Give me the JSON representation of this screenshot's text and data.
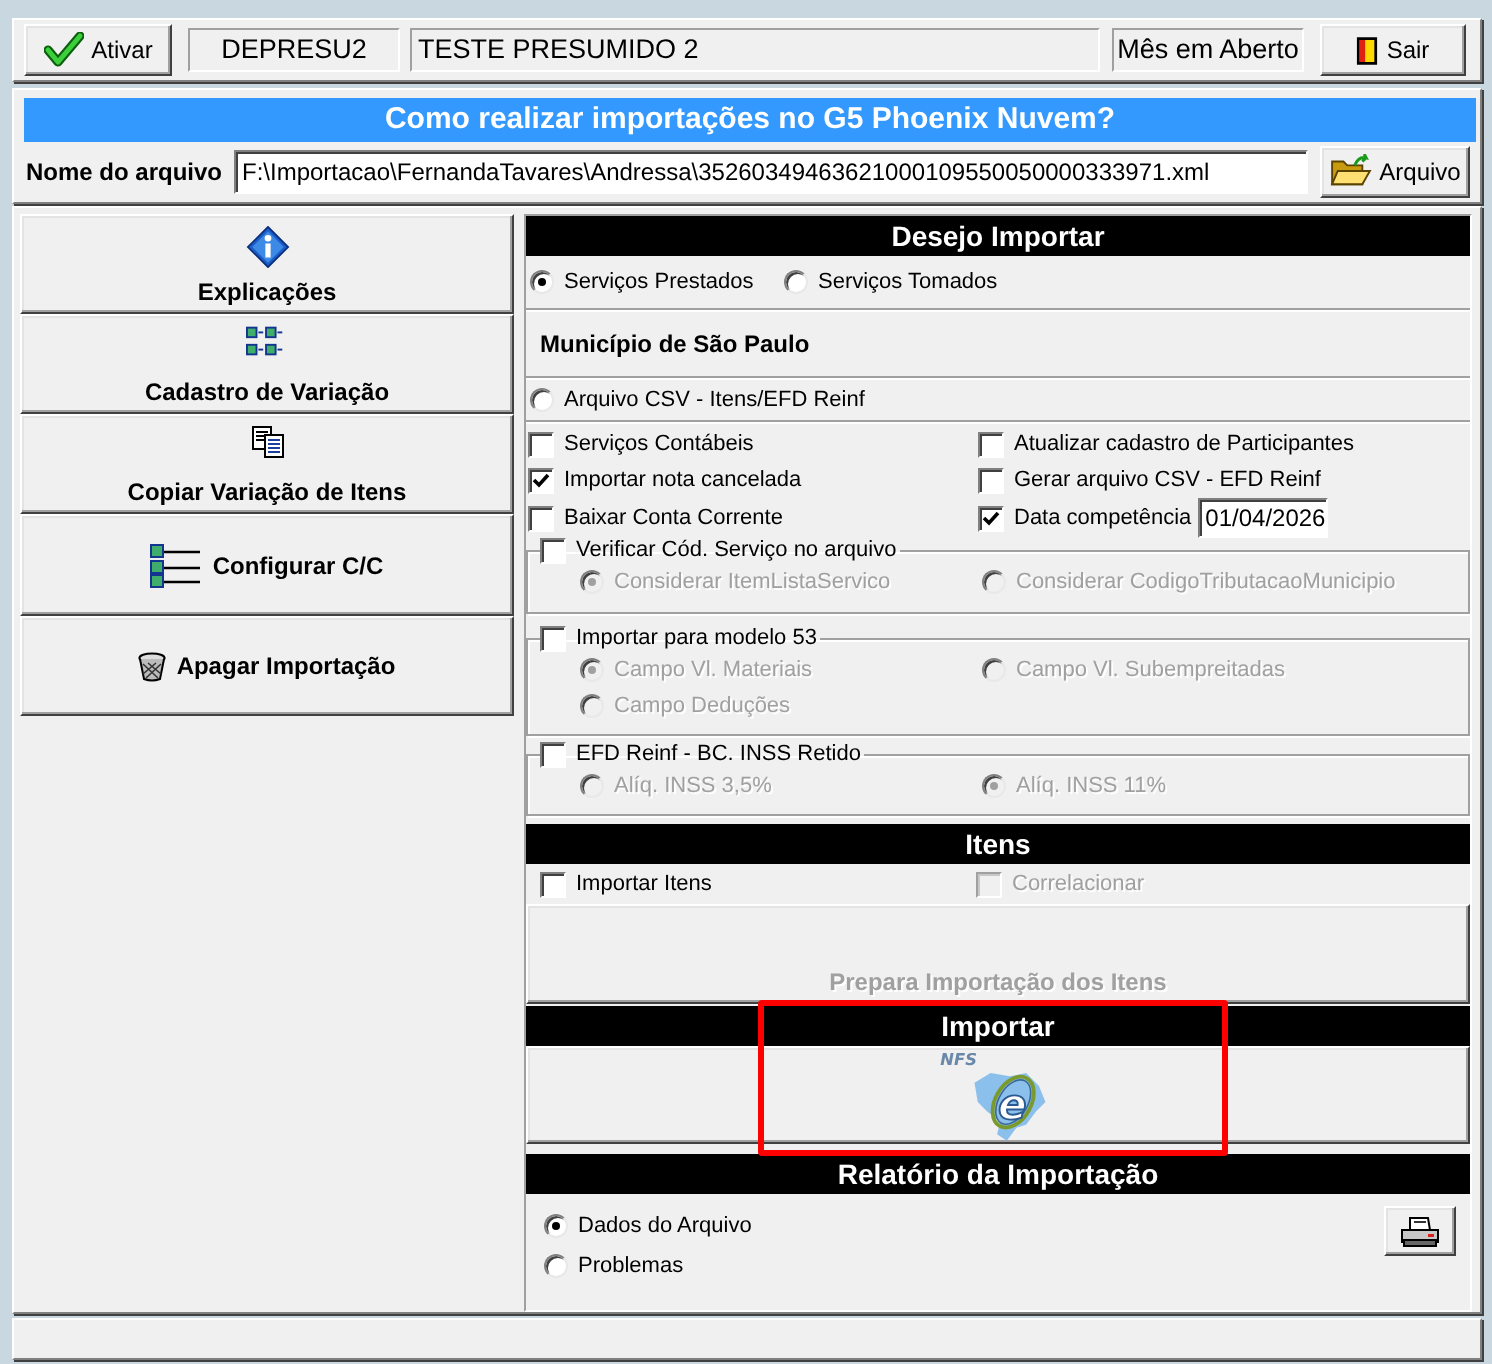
{
  "toolbar": {
    "activate_button": {
      "label": "Ativar"
    },
    "fields": [
      "DEPRESU2",
      "TESTE PRESUMIDO 2",
      "Mês em Aberto"
    ],
    "exit_button": {
      "label": "Sair"
    }
  },
  "file_panel": {
    "title": "Como realizar importações no G5 Phoenix Nuvem?",
    "file_label": "Nome do arquivo",
    "file_path": "F:\\Importacao\\FernandaTavares\\Andressa\\35260349463621000109550050000333971.xml",
    "browse_button": "Arquivo"
  },
  "sidebar": {
    "items": [
      {
        "kind": "info",
        "label": "Explicações"
      },
      {
        "kind": "variation",
        "label": "Cadastro de Variação"
      },
      {
        "kind": "copy",
        "label": "Copiar Variação de Itens"
      },
      {
        "kind": "config",
        "label": "Configurar C/C"
      },
      {
        "kind": "delete",
        "label": "Apagar Importação"
      }
    ]
  },
  "import_panel": {
    "title": "Desejo Importar",
    "service_types": [
      {
        "label": "Serviços Prestados",
        "selected": true
      },
      {
        "label": "Serviços Tomados",
        "selected": false
      }
    ],
    "municipality": "Município de São Paulo",
    "csv_option": {
      "label": "Arquivo CSV - Itens/EFD Reinf",
      "selected": false
    },
    "options": [
      {
        "label": "Serviços Contábeis",
        "checked": false
      },
      {
        "label": "Atualizar cadastro de Participantes",
        "checked": false
      },
      {
        "label": "Importar nota cancelada",
        "checked": true
      },
      {
        "label": "Gerar arquivo CSV - EFD Reinf",
        "checked": false
      },
      {
        "label": "Baixar Conta Corrente",
        "checked": false
      },
      {
        "label": "Data competência",
        "checked": true,
        "date": "01/04/2026"
      }
    ],
    "groups": [
      {
        "label": "Verificar Cód. Serviço no arquivo",
        "checked": false,
        "options": [
          {
            "label": "Considerar ItemListaServico",
            "selected": true,
            "disabled": true
          },
          {
            "label": "Considerar CodigoTributacaoMunicipio",
            "selected": false,
            "disabled": true
          }
        ]
      },
      {
        "label": "Importar para modelo 53",
        "checked": false,
        "options": [
          {
            "label": "Campo Vl. Materiais",
            "selected": true,
            "disabled": true
          },
          {
            "label": "Campo Vl. Subempreitadas",
            "selected": false,
            "disabled": true
          },
          {
            "label": "Campo Deduções",
            "selected": false,
            "disabled": true
          }
        ]
      },
      {
        "label": "EFD Reinf - BC. INSS Retido",
        "checked": false,
        "options": [
          {
            "label": "Alíq. INSS 3,5%",
            "selected": false,
            "disabled": true
          },
          {
            "label": "Alíq. INSS 11%",
            "selected": true,
            "disabled": true
          }
        ]
      }
    ]
  },
  "items_panel": {
    "title": "Itens",
    "checkboxes": [
      {
        "label": "Importar Itens",
        "checked": false,
        "disabled": false
      },
      {
        "label": "Correlacionar",
        "checked": false,
        "disabled": true
      }
    ],
    "prepare_button": {
      "label": "Prepara Importação dos Itens",
      "disabled": true
    }
  },
  "run_panel": {
    "title": "Importar",
    "highlighted": true,
    "logo": {
      "text": "NFS",
      "letter": "e"
    }
  },
  "report_panel": {
    "title": "Relatório da Importação",
    "views": [
      {
        "label": "Dados do Arquivo",
        "selected": true
      },
      {
        "label": "Problemas",
        "selected": false
      }
    ]
  }
}
